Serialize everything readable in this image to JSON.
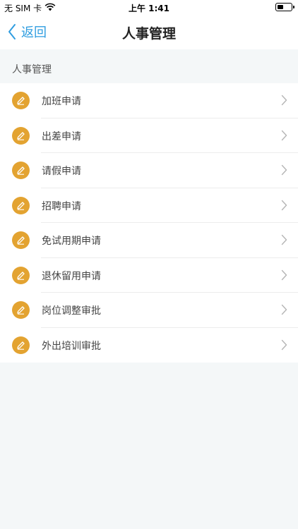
{
  "status_bar": {
    "carrier": "无 SIM 卡",
    "time": "上午 1:41",
    "battery_level": 0.45,
    "icons": [
      "wifi-icon",
      "battery-icon"
    ]
  },
  "nav": {
    "back_label": "返回",
    "title": "人事管理",
    "accent_color": "#2f9de0"
  },
  "section": {
    "header": "人事管理"
  },
  "list": {
    "icon": "pencil-icon",
    "icon_color": "#e3a331",
    "items": [
      {
        "label": "加班申请"
      },
      {
        "label": "出差申请"
      },
      {
        "label": "请假申请"
      },
      {
        "label": "招聘申请"
      },
      {
        "label": "免试用期申请"
      },
      {
        "label": "退休留用申请"
      },
      {
        "label": "岗位调整审批"
      },
      {
        "label": "外出培训审批"
      }
    ]
  }
}
